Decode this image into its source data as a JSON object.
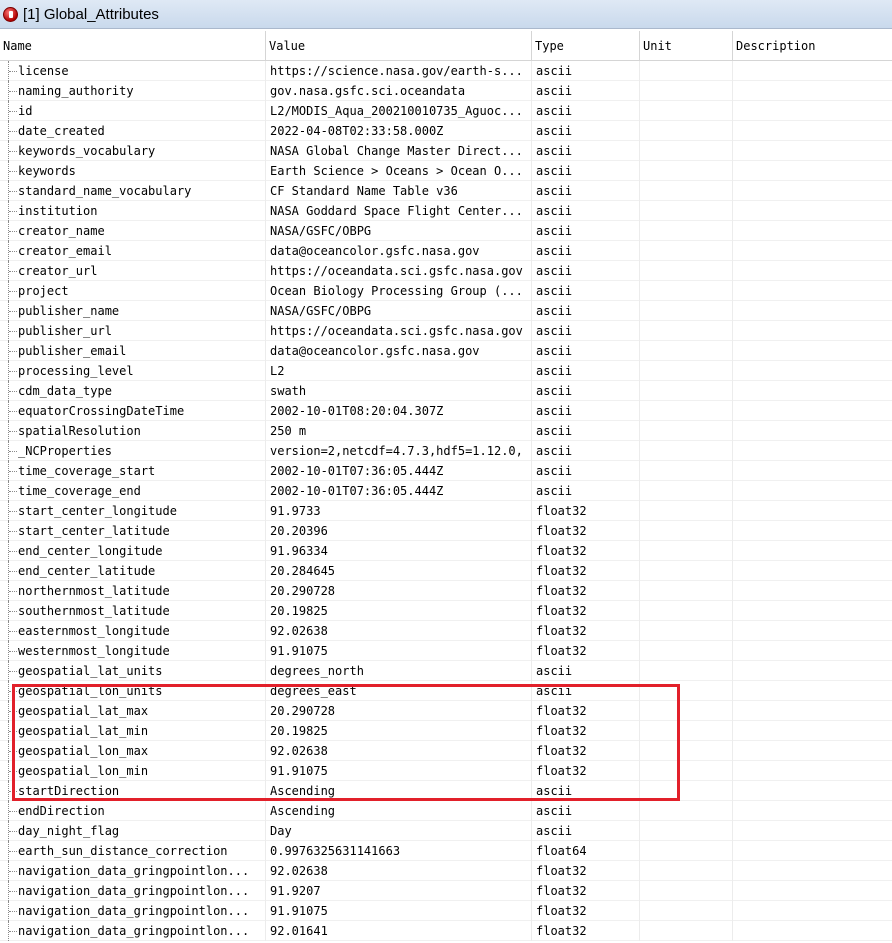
{
  "window": {
    "title": "[1] Global_Attributes",
    "icon": "hdf-attribute-icon"
  },
  "columns": [
    "Name",
    "Value",
    "Type",
    "Unit",
    "Description"
  ],
  "rows": [
    {
      "name": "license",
      "value": "https://science.nasa.gov/earth-s...",
      "type": "ascii",
      "unit": "",
      "desc": ""
    },
    {
      "name": "naming_authority",
      "value": "gov.nasa.gsfc.sci.oceandata",
      "type": "ascii",
      "unit": "",
      "desc": ""
    },
    {
      "name": "id",
      "value": "L2/MODIS_Aqua_200210010735_Aguoc...",
      "type": "ascii",
      "unit": "",
      "desc": ""
    },
    {
      "name": "date_created",
      "value": "2022-04-08T02:33:58.000Z",
      "type": "ascii",
      "unit": "",
      "desc": ""
    },
    {
      "name": "keywords_vocabulary",
      "value": "NASA Global Change Master Direct...",
      "type": "ascii",
      "unit": "",
      "desc": ""
    },
    {
      "name": "keywords",
      "value": "Earth Science > Oceans > Ocean O...",
      "type": "ascii",
      "unit": "",
      "desc": ""
    },
    {
      "name": "standard_name_vocabulary",
      "value": "CF Standard Name Table v36",
      "type": "ascii",
      "unit": "",
      "desc": ""
    },
    {
      "name": "institution",
      "value": "NASA Goddard Space Flight Center...",
      "type": "ascii",
      "unit": "",
      "desc": ""
    },
    {
      "name": "creator_name",
      "value": "NASA/GSFC/OBPG",
      "type": "ascii",
      "unit": "",
      "desc": ""
    },
    {
      "name": "creator_email",
      "value": "data@oceancolor.gsfc.nasa.gov",
      "type": "ascii",
      "unit": "",
      "desc": ""
    },
    {
      "name": "creator_url",
      "value": "https://oceandata.sci.gsfc.nasa.gov",
      "type": "ascii",
      "unit": "",
      "desc": ""
    },
    {
      "name": "project",
      "value": "Ocean Biology Processing Group (...",
      "type": "ascii",
      "unit": "",
      "desc": ""
    },
    {
      "name": "publisher_name",
      "value": "NASA/GSFC/OBPG",
      "type": "ascii",
      "unit": "",
      "desc": ""
    },
    {
      "name": "publisher_url",
      "value": "https://oceandata.sci.gsfc.nasa.gov",
      "type": "ascii",
      "unit": "",
      "desc": ""
    },
    {
      "name": "publisher_email",
      "value": "data@oceancolor.gsfc.nasa.gov",
      "type": "ascii",
      "unit": "",
      "desc": ""
    },
    {
      "name": "processing_level",
      "value": "L2",
      "type": "ascii",
      "unit": "",
      "desc": ""
    },
    {
      "name": "cdm_data_type",
      "value": "swath",
      "type": "ascii",
      "unit": "",
      "desc": ""
    },
    {
      "name": "equatorCrossingDateTime",
      "value": "2002-10-01T08:20:04.307Z",
      "type": "ascii",
      "unit": "",
      "desc": ""
    },
    {
      "name": "spatialResolution",
      "value": "250 m",
      "type": "ascii",
      "unit": "",
      "desc": ""
    },
    {
      "name": "_NCProperties",
      "value": "version=2,netcdf=4.7.3,hdf5=1.12.0,",
      "type": "ascii",
      "unit": "",
      "desc": ""
    },
    {
      "name": "time_coverage_start",
      "value": "2002-10-01T07:36:05.444Z",
      "type": "ascii",
      "unit": "",
      "desc": ""
    },
    {
      "name": "time_coverage_end",
      "value": "2002-10-01T07:36:05.444Z",
      "type": "ascii",
      "unit": "",
      "desc": ""
    },
    {
      "name": "start_center_longitude",
      "value": "91.9733",
      "type": "float32",
      "unit": "",
      "desc": ""
    },
    {
      "name": "start_center_latitude",
      "value": "20.20396",
      "type": "float32",
      "unit": "",
      "desc": ""
    },
    {
      "name": "end_center_longitude",
      "value": "91.96334",
      "type": "float32",
      "unit": "",
      "desc": ""
    },
    {
      "name": "end_center_latitude",
      "value": "20.284645",
      "type": "float32",
      "unit": "",
      "desc": ""
    },
    {
      "name": "northernmost_latitude",
      "value": "20.290728",
      "type": "float32",
      "unit": "",
      "desc": ""
    },
    {
      "name": "southernmost_latitude",
      "value": "20.19825",
      "type": "float32",
      "unit": "",
      "desc": ""
    },
    {
      "name": "easternmost_longitude",
      "value": "92.02638",
      "type": "float32",
      "unit": "",
      "desc": ""
    },
    {
      "name": "westernmost_longitude",
      "value": "91.91075",
      "type": "float32",
      "unit": "",
      "desc": ""
    },
    {
      "name": "geospatial_lat_units",
      "value": "degrees_north",
      "type": "ascii",
      "unit": "",
      "desc": ""
    },
    {
      "name": "geospatial_lon_units",
      "value": "degrees_east",
      "type": "ascii",
      "unit": "",
      "desc": ""
    },
    {
      "name": "geospatial_lat_max",
      "value": "20.290728",
      "type": "float32",
      "unit": "",
      "desc": ""
    },
    {
      "name": "geospatial_lat_min",
      "value": "20.19825",
      "type": "float32",
      "unit": "",
      "desc": ""
    },
    {
      "name": "geospatial_lon_max",
      "value": "92.02638",
      "type": "float32",
      "unit": "",
      "desc": ""
    },
    {
      "name": "geospatial_lon_min",
      "value": "91.91075",
      "type": "float32",
      "unit": "",
      "desc": ""
    },
    {
      "name": "startDirection",
      "value": "Ascending",
      "type": "ascii",
      "unit": "",
      "desc": ""
    },
    {
      "name": "endDirection",
      "value": "Ascending",
      "type": "ascii",
      "unit": "",
      "desc": ""
    },
    {
      "name": "day_night_flag",
      "value": "Day",
      "type": "ascii",
      "unit": "",
      "desc": ""
    },
    {
      "name": "earth_sun_distance_correction",
      "value": "0.9976325631141663",
      "type": "float64",
      "unit": "",
      "desc": ""
    },
    {
      "name": "navigation_data_gringpointlon...",
      "value": "92.02638",
      "type": "float32",
      "unit": "",
      "desc": ""
    },
    {
      "name": "navigation_data_gringpointlon...",
      "value": "91.9207",
      "type": "float32",
      "unit": "",
      "desc": ""
    },
    {
      "name": "navigation_data_gringpointlon...",
      "value": "91.91075",
      "type": "float32",
      "unit": "",
      "desc": ""
    },
    {
      "name": "navigation_data_gringpointlon...",
      "value": "92.01641",
      "type": "float32",
      "unit": "",
      "desc": ""
    }
  ],
  "highlight_color": "#e2202a"
}
